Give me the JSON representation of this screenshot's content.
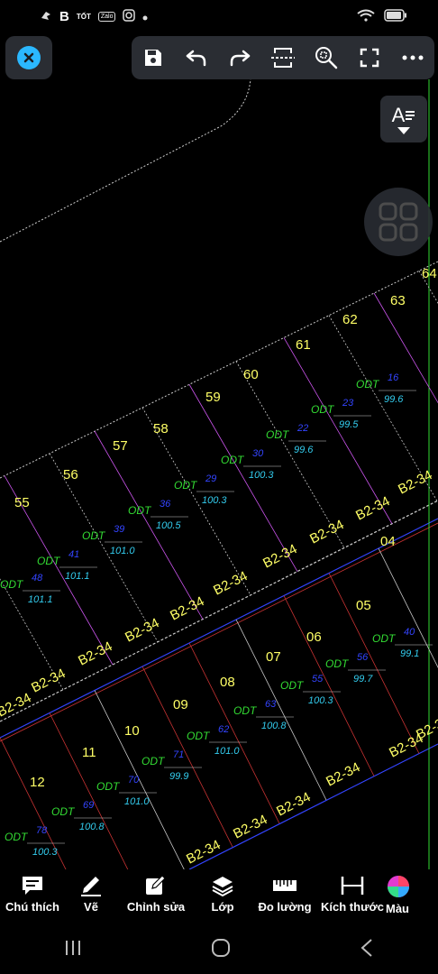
{
  "status_bar": {
    "left_icons": [
      "bird-icon",
      "b-app-icon",
      "tot-icon",
      "zalo-icon",
      "instagram-icon",
      "dot-icon"
    ],
    "tot_text": "TỐT",
    "zalo_text": "Zalo",
    "right_icons": [
      "wifi-icon",
      "battery-icon"
    ]
  },
  "toolbar": {
    "buttons": [
      "save-icon",
      "undo-icon",
      "redo-icon",
      "fit-icon",
      "zoom-icon",
      "fullscreen-icon",
      "more-icon"
    ]
  },
  "text_style_label": "A",
  "drawing": {
    "lots_upper": [
      "55",
      "56",
      "57",
      "58",
      "59",
      "60",
      "61",
      "62",
      "63",
      "64"
    ],
    "lots_lower": [
      "04",
      "05",
      "06",
      "07",
      "08",
      "09",
      "10",
      "11",
      "12"
    ],
    "road_label": "B2-34",
    "land_type": "ODT",
    "parcels": [
      {
        "num": "48",
        "area": "101.1"
      },
      {
        "num": "41",
        "area": "101.1"
      },
      {
        "num": "39",
        "area": "101.0"
      },
      {
        "num": "36",
        "area": "100.5"
      },
      {
        "num": "29",
        "area": "100.3"
      },
      {
        "num": "30",
        "area": "100.3"
      },
      {
        "num": "22",
        "area": "99.6"
      },
      {
        "num": "23",
        "area": "99.5"
      },
      {
        "num": "16",
        "area": "99.6"
      },
      {
        "num": "40",
        "area": "99.1"
      },
      {
        "num": "56",
        "area": "99.7"
      },
      {
        "num": "55",
        "area": "100.3"
      },
      {
        "num": "63",
        "area": "100.8"
      },
      {
        "num": "62",
        "area": "101.0"
      },
      {
        "num": "71",
        "area": "99.9"
      },
      {
        "num": "70",
        "area": "101.0"
      },
      {
        "num": "69",
        "area": "100.8"
      },
      {
        "num": "78",
        "area": "100.3"
      }
    ]
  },
  "bottom_tools": [
    {
      "label": "Chú thích",
      "icon": "comment-icon"
    },
    {
      "label": "Vẽ",
      "icon": "pencil-icon"
    },
    {
      "label": "Chỉnh sửa",
      "icon": "edit-icon"
    },
    {
      "label": "Lớp",
      "icon": "layers-icon"
    },
    {
      "label": "Đo lường",
      "icon": "ruler-icon"
    },
    {
      "label": "Kích thước",
      "icon": "dimension-icon"
    },
    {
      "label": "Màu",
      "icon": "color-icon"
    }
  ],
  "colors": {
    "accent": "#2bb8ff",
    "lot_number": "#ffff66",
    "land_type": "#33dd33",
    "parcel_number": "#3344ff",
    "area": "#33ccee",
    "road_label": "#ffff66",
    "panel": "#2a2d33"
  }
}
